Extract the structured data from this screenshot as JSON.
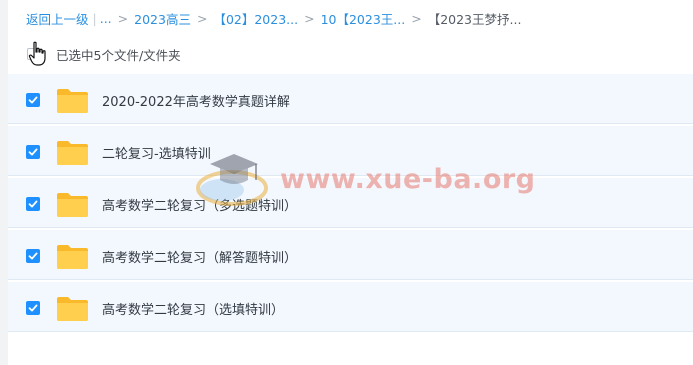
{
  "breadcrumb": {
    "back": "返回上一级",
    "ellipsis": "...",
    "items": [
      "2023高三",
      "【02】2023...",
      "10【2023王...",
      "【2023王梦抒..."
    ]
  },
  "selection": {
    "count_text": "已选中5个文件/文件夹"
  },
  "files": [
    {
      "name": "2020-2022年高考数学真题详解",
      "checked": true
    },
    {
      "name": "二轮复习-选填特训",
      "checked": true
    },
    {
      "name": "高考数学二轮复习（多选题特训）",
      "checked": true
    },
    {
      "name": "高考数学二轮复习（解答题特训）",
      "checked": true
    },
    {
      "name": "高考数学二轮复习（选填特训）",
      "checked": true
    }
  ],
  "icons": {
    "folder": "folder-icon",
    "checkbox": "checkbox-checked-icon",
    "cursor": "hand-pointer-icon"
  },
  "colors": {
    "link": "#2b8fdf",
    "checkbox": "#1e90ff",
    "folder": "#ffc83d",
    "row_bg": "#f3f8fe"
  },
  "watermark": {
    "text": "www.xue-ba.org"
  }
}
